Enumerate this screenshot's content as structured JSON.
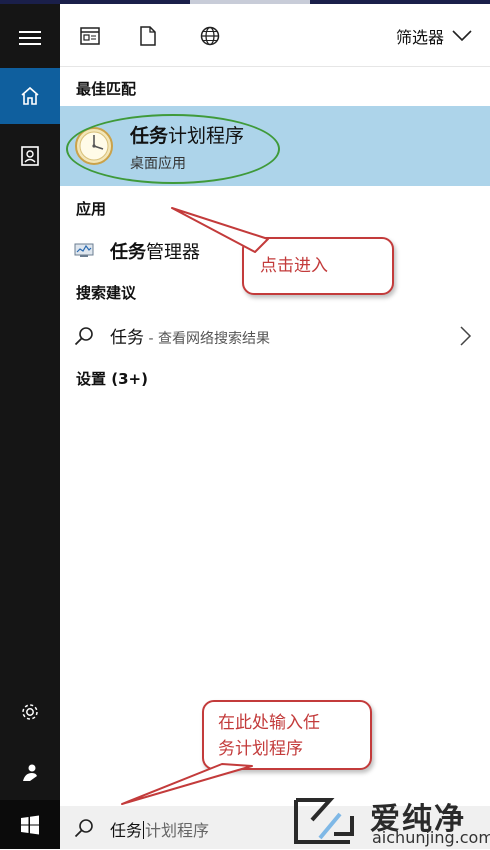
{
  "toolbar": {
    "filter_label": "筛选器"
  },
  "sections": {
    "best_match": "最佳匹配",
    "apps": "应用",
    "suggestions": "搜索建议",
    "settings": "设置 (3+)"
  },
  "best_match": {
    "title_bold": "任务",
    "title_rest": "计划程序",
    "subtitle": "桌面应用"
  },
  "apps": [
    {
      "name_bold": "任务",
      "name_rest": "管理器"
    }
  ],
  "suggestion": {
    "query": "任务",
    "hint": " - 查看网络搜索结果"
  },
  "annotations": {
    "click_enter": "点击进入",
    "type_line1": "在此处输入任",
    "type_line2": "务计划程序"
  },
  "search": {
    "typed": "任务",
    "suggested": "计划程序"
  },
  "watermark": {
    "brand": "爱纯净",
    "url": "aichunjing.com"
  },
  "colors": {
    "accent": "#0f5f9e",
    "highlight": "#add4ea",
    "callout": "#c33b3b",
    "ellipse": "#3f9a3a"
  }
}
